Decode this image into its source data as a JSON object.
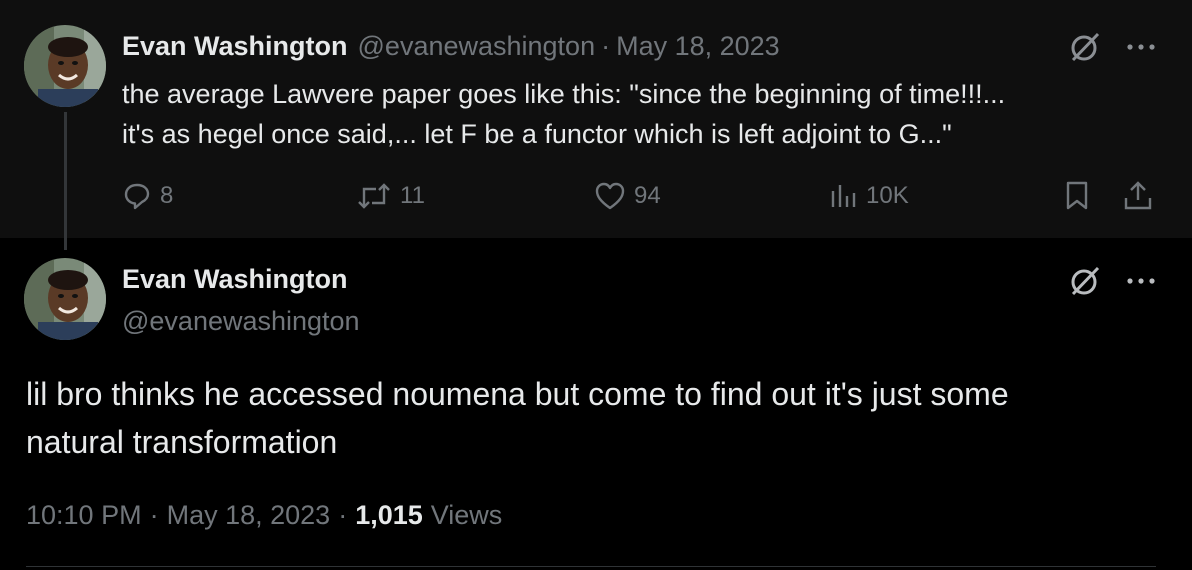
{
  "parent_tweet": {
    "display_name": "Evan Washington",
    "handle": "@evanewashington",
    "separator": "·",
    "date": "May 18, 2023",
    "text_lines": [
      "the average Lawvere paper goes like this: \"since the beginning of time!!!...",
      "it's as hegel once said,... let F be a functor which is left adjoint to G...\""
    ],
    "actions": {
      "replies": "8",
      "retweets": "11",
      "likes": "94",
      "views": "10K"
    },
    "icons": [
      "reply-icon",
      "retweet-icon",
      "like-icon",
      "views-icon",
      "bookmark-icon",
      "share-icon",
      "grok-icon",
      "more-icon"
    ]
  },
  "main_tweet": {
    "display_name": "Evan Washington",
    "handle": "@evanewashington",
    "text_lines": [
      "lil bro thinks he accessed noumena but come to find out it's just some",
      "natural transformation"
    ],
    "time": "10:10 PM",
    "separator": "·",
    "date": "May 18, 2023",
    "separator2": "·",
    "view_count": "1,015",
    "views_label": "Views"
  },
  "colors": {
    "background": "#000000",
    "parent_background": "#0f0f0f",
    "text_primary": "#e7e9ea",
    "text_secondary": "#71767b"
  }
}
